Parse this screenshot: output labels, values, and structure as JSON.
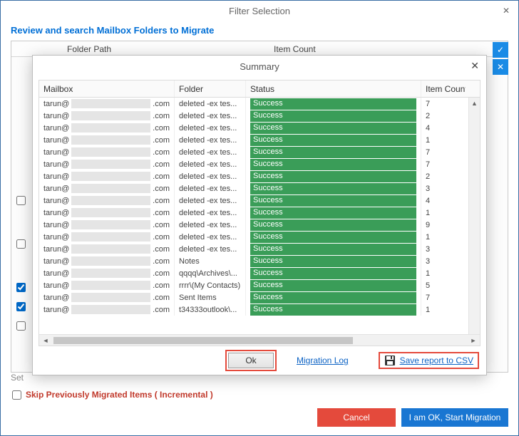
{
  "outer": {
    "title": "Filter Selection",
    "heading": "Review and search Mailbox Folders to Migrate",
    "columns": {
      "folder_path": "Folder Path",
      "item_count": "Item Count"
    },
    "settings_label": "Set",
    "skip_label": "Skip Previously Migrated Items ( Incremental )",
    "cancel": "Cancel",
    "start": "I am OK, Start Migration"
  },
  "modal": {
    "title": "Summary",
    "columns": {
      "mailbox": "Mailbox",
      "folder": "Folder",
      "status": "Status",
      "item_count": "Item Count"
    },
    "rows": [
      {
        "mailbox_prefix": "tarun@",
        "mailbox_suffix": ".com",
        "folder": "deleted -ex tes...",
        "status": "Success",
        "item_count": 7
      },
      {
        "mailbox_prefix": "tarun@",
        "mailbox_suffix": ".com",
        "folder": "deleted -ex tes...",
        "status": "Success",
        "item_count": 2
      },
      {
        "mailbox_prefix": "tarun@",
        "mailbox_suffix": ".com",
        "folder": "deleted -ex tes...",
        "status": "Success",
        "item_count": 4
      },
      {
        "mailbox_prefix": "tarun@",
        "mailbox_suffix": ".com",
        "folder": "deleted -ex tes...",
        "status": "Success",
        "item_count": 1
      },
      {
        "mailbox_prefix": "tarun@",
        "mailbox_suffix": ".com",
        "folder": "deleted -ex tes...",
        "status": "Success",
        "item_count": 7
      },
      {
        "mailbox_prefix": "tarun@",
        "mailbox_suffix": ".com",
        "folder": "deleted -ex tes...",
        "status": "Success",
        "item_count": 7
      },
      {
        "mailbox_prefix": "tarun@",
        "mailbox_suffix": ".com",
        "folder": "deleted -ex tes...",
        "status": "Success",
        "item_count": 2
      },
      {
        "mailbox_prefix": "tarun@",
        "mailbox_suffix": ".com",
        "folder": "deleted -ex tes...",
        "status": "Success",
        "item_count": 3
      },
      {
        "mailbox_prefix": "tarun@",
        "mailbox_suffix": ".com",
        "folder": "deleted -ex tes...",
        "status": "Success",
        "item_count": 4
      },
      {
        "mailbox_prefix": "tarun@",
        "mailbox_suffix": ".com",
        "folder": "deleted -ex tes...",
        "status": "Success",
        "item_count": 1
      },
      {
        "mailbox_prefix": "tarun@",
        "mailbox_suffix": ".com",
        "folder": "deleted -ex tes...",
        "status": "Success",
        "item_count": 9
      },
      {
        "mailbox_prefix": "tarun@",
        "mailbox_suffix": ".com",
        "folder": "deleted -ex tes...",
        "status": "Success",
        "item_count": 1
      },
      {
        "mailbox_prefix": "tarun@",
        "mailbox_suffix": ".com",
        "folder": "deleted -ex tes...",
        "status": "Success",
        "item_count": 3
      },
      {
        "mailbox_prefix": "tarun@",
        "mailbox_suffix": ".com",
        "folder": "Notes",
        "status": "Success",
        "item_count": 3
      },
      {
        "mailbox_prefix": "tarun@",
        "mailbox_suffix": ".com",
        "folder": "qqqq\\Archives\\...",
        "status": "Success",
        "item_count": 1
      },
      {
        "mailbox_prefix": "tarun@",
        "mailbox_suffix": ".com",
        "folder": "rrrr\\(My Contacts)",
        "status": "Success",
        "item_count": 5
      },
      {
        "mailbox_prefix": "tarun@",
        "mailbox_suffix": ".com",
        "folder": "Sent Items",
        "status": "Success",
        "item_count": 7
      },
      {
        "mailbox_prefix": "tarun@",
        "mailbox_suffix": ".com",
        "folder": "t34333outlook\\...",
        "status": "Success",
        "item_count": 1
      }
    ],
    "ok": "Ok",
    "migration_log": "Migration Log",
    "save_csv": "Save report to CSV"
  }
}
